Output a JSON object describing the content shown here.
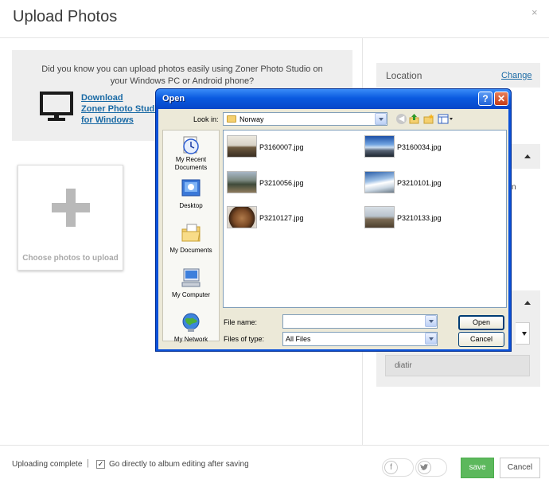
{
  "page": {
    "title": "Upload Photos",
    "close_glyph": "×"
  },
  "promo": {
    "text_line1": "Did you know you can upload photos easily using Zoner Photo Studio on",
    "text_line2": "your Windows PC or Android phone?",
    "link_line1": "Download",
    "link_line2": "Zoner Photo Studio",
    "link_line3": "for Windows",
    "icon": "monitor-icon"
  },
  "uploader": {
    "choose_label": "Choose photos to upload",
    "icon": "plus-icon"
  },
  "sidebar": {
    "location_label": "Location",
    "change_link": "Change",
    "partial_text": "n",
    "tag_value": "diatir"
  },
  "footer": {
    "status": "Uploading complete",
    "separator": "|",
    "checkbox_checked": true,
    "checkbox_label": "Go directly to album editing after saving",
    "facebook_icon": "facebook-icon",
    "twitter_icon": "twitter-icon",
    "save_label": "save",
    "cancel_label": "Cancel",
    "save_color": "#5cb85c"
  },
  "dialog": {
    "title": "Open",
    "help_glyph": "?",
    "close_glyph": "✕",
    "look_in_label": "Look in:",
    "look_in_value": "Norway",
    "places": [
      {
        "line1": "My Recent",
        "line2": "Documents",
        "icon": "recent-documents-icon"
      },
      {
        "line1": "Desktop",
        "line2": "",
        "icon": "desktop-icon"
      },
      {
        "line1": "My Documents",
        "line2": "",
        "icon": "my-documents-icon"
      },
      {
        "line1": "My Computer",
        "line2": "",
        "icon": "my-computer-icon"
      },
      {
        "line1": "My Network",
        "line2": "",
        "icon": "my-network-icon"
      }
    ],
    "files": [
      {
        "name": "P3160007.jpg"
      },
      {
        "name": "P3160034.jpg"
      },
      {
        "name": "P3210056.jpg"
      },
      {
        "name": "P3210101.jpg"
      },
      {
        "name": "P3210127.jpg"
      },
      {
        "name": "P3210133.jpg"
      }
    ],
    "file_name_label": "File name:",
    "file_name_value": "",
    "file_type_label": "Files of type:",
    "file_type_value": "All Files",
    "open_button": "Open",
    "cancel_button": "Cancel"
  }
}
